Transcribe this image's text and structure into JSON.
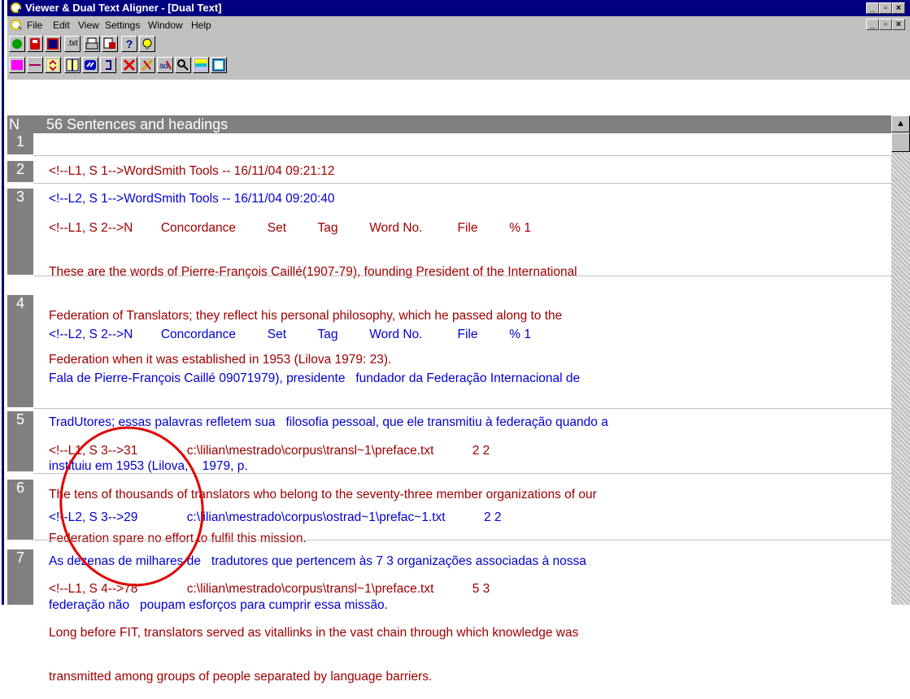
{
  "window": {
    "title": "Viewer & Dual Text Aligner - [Dual Text]",
    "min_glyph": "_",
    "max_glyph": "▫",
    "close_glyph": "×"
  },
  "menu": {
    "items": [
      "File",
      "Edit",
      "View",
      "Settings",
      "Window",
      "Help"
    ]
  },
  "toolbar1": {
    "buttons": [
      "circle-green",
      "save",
      "help-book",
      "txt",
      "print",
      "print-preview",
      "help",
      "tip"
    ],
    "txt_label": ".txt",
    "help_label": "?"
  },
  "toolbar2": {
    "buttons": [
      "magenta",
      "line",
      "swap",
      "columns",
      "link",
      "bracket",
      "cut",
      "unlink",
      "split",
      "search",
      "yellow-gradient",
      "box"
    ]
  },
  "grid": {
    "header": {
      "n": "N",
      "title": "56 Sentences and headings"
    },
    "rows": [
      {
        "num": "1",
        "color": "red",
        "lines": [
          "<!--L1, S 1-->WordSmith Tools -- 16/11/04 09:21:12"
        ]
      },
      {
        "num": "2",
        "color": "blue",
        "lines": [
          "<!--L2, S 1-->WordSmith Tools -- 16/11/04 09:20:40"
        ]
      },
      {
        "num": "3",
        "color": "red",
        "lines": [
          "<!--L1, S 2-->N        Concordance         Set         Tag         Word No.          File         % 1",
          "These are the words of Pierre-François Caillé(1907-79), founding President of the International",
          "Federation of Translators; they reflect his personal philosophy, which he passed along to the",
          "Federation when it was established in 1953 (Lilova 1979: 23)."
        ]
      },
      {
        "num": "4",
        "color": "blue",
        "lines": [
          "<!--L2, S 2-->N        Concordance         Set         Tag         Word No.          File         % 1",
          "Fala de Pierre-François Caillé 09071979), presidente   fundador da Federação Internacional de",
          "TradUtores; essas palavras refletem sua   filosofia pessoal, que ele transmitiu à federação quando a",
          "instituiu em 1953 (Lilova,    1979, p."
        ]
      },
      {
        "num": "5",
        "color": "red",
        "lines": [
          "<!--L1, S 3-->31              c:\\lilian\\mestrado\\corpus\\transl~1\\preface.txt           2 2",
          "The tens of thousands of translators who belong to the seventy-three member organizations of our",
          "Federation spare no effort to fulfil this mission."
        ]
      },
      {
        "num": "6",
        "color": "blue",
        "lines": [
          "<!--L2, S 3-->29              c:\\lilian\\mestrado\\corpus\\ostrad~1\\prefac~1.txt           2 2",
          "As dezenas de milhares de   tradutores que pertencem às 7 3 organizações associadas à nossa",
          "federação não   poupam esforços para cumprir essa missão."
        ]
      },
      {
        "num": "7",
        "color": "red",
        "lines": [
          "<!--L1, S 4-->78              c:\\lilian\\mestrado\\corpus\\transl~1\\preface.txt           5 3",
          "Long before FIT, translators served as vitallinks in the vast chain through which knowledge was",
          "transmitted among groups of people separated by language barriers."
        ]
      }
    ]
  },
  "colors": {
    "title_bg": "#000080",
    "chrome": "#c0c0c0",
    "l1_text": "#a00000",
    "l2_text": "#0000d0",
    "annotation": "#e00000"
  }
}
